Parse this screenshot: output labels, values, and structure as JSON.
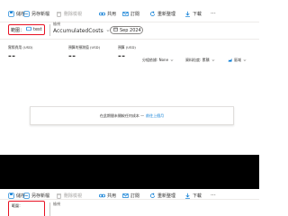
{
  "toolbar": {
    "save": "儲存",
    "save_as": "另存新檔",
    "delete_view": "刪除檢視",
    "share": "共用",
    "subscribe": "訂閱",
    "refresh": "重新整理",
    "download": "下載"
  },
  "scope": {
    "label": "範圍：",
    "value": "test"
  },
  "view": {
    "label": "檢視",
    "value": "AccumulatedCosts"
  },
  "date_range": {
    "value": "Sep 2024"
  },
  "kpis": [
    {
      "label": "實際費用 (USD)",
      "value": "--"
    },
    {
      "label": "預算的預測值 (USD)",
      "value": "--"
    },
    {
      "label": "預算 (USD)",
      "value": "--"
    }
  ],
  "controls": {
    "group_by": "分組依據: None",
    "granularity": "資料粒度: 累積",
    "chart_type": "區域"
  },
  "empty_message": {
    "text": "在此期間未開較任何成本 —",
    "link": "前往上個月"
  },
  "bottom_panel": {
    "scope_label": "範圍：",
    "view_label": "檢視"
  },
  "colors": {
    "highlight": "#e81123",
    "link": "#0078d4"
  }
}
